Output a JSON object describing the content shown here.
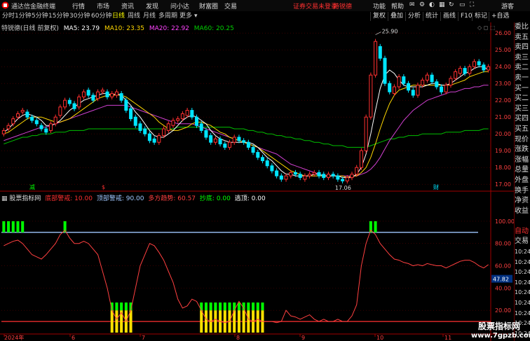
{
  "menu": {
    "app_name": "通达信金融终端",
    "items": [
      "行情",
      "市场",
      "资讯",
      "发现",
      "问小达",
      "财富圈",
      "交易"
    ],
    "login_status": "证券交易未登录",
    "stock_name": "特锐德",
    "right_items": [
      "功能",
      "帮助"
    ],
    "guest": "游客"
  },
  "tabs": {
    "periods": [
      "分时",
      "1分钟",
      "5分钟",
      "15分钟",
      "30分钟",
      "60分钟",
      "日线",
      "周线",
      "月线",
      "多周期",
      "更多"
    ],
    "active": "日线",
    "right_buttons": [
      "复权",
      "叠加",
      "分析",
      "统计",
      "画线",
      "F10",
      "标记",
      "+自选"
    ]
  },
  "main_chart": {
    "title": "特锐德(日线 前复权)",
    "ma": [
      {
        "label": "MA5: 23.79",
        "color": "#ffffff"
      },
      {
        "label": "MA10: 23.35",
        "color": "#ffd700"
      },
      {
        "label": "MA20: 22.92",
        "color": "#ff44ff"
      },
      {
        "label": "MA60: 20.25",
        "color": "#00d000"
      }
    ],
    "y_ticks": [
      "26.00",
      "25.00",
      "24.00",
      "23.00",
      "22.00",
      "21.00",
      "20.00",
      "19.00",
      "18.00",
      "17.00"
    ],
    "high_label": "25.90",
    "low_label": "17.06",
    "markers": [
      "减",
      "$",
      "财"
    ]
  },
  "indicator": {
    "title": "股票指标网",
    "params": [
      {
        "label": "底部警戒: 10.00",
        "color": "#ff3030"
      },
      {
        "label": "顶部警戒: 90.00",
        "color": "#a0c8ff"
      },
      {
        "label": "多方趋势: 60.57",
        "color": "#ff4040"
      },
      {
        "label": "抄底: 0.00",
        "color": "#00ff00"
      },
      {
        "label": "逃顶: 0.00",
        "color": "#ffffff"
      }
    ],
    "y_ticks": [
      "100.00",
      "80.00",
      "60.00",
      "40.00",
      "20.00"
    ],
    "current_value": "47.82"
  },
  "x_axis": [
    "2024年",
    "6",
    "7",
    "8",
    "9",
    "10",
    "11"
  ],
  "right_panel": [
    "委比",
    "卖五",
    "卖四",
    "卖三",
    "卖二",
    "卖一",
    "买一",
    "买二",
    "买三",
    "买四",
    "买五",
    "现价",
    "涨跌",
    "涨幅",
    "总量",
    "外盘",
    "换手",
    "净资",
    "收益",
    "",
    "自动",
    "交易",
    "10:24",
    "10:24",
    "10:24",
    "10:24",
    "10:24",
    "10:24",
    "10:24",
    "10:24",
    "10:24"
  ],
  "watermark": {
    "line1": "股票指标网",
    "line2": "www.7gpzb.com"
  },
  "chart_data": {
    "type": "candlestick",
    "ylim": [
      16.8,
      26.3
    ],
    "close": [
      20.2,
      20.5,
      20.9,
      21.2,
      21.4,
      21.0,
      20.8,
      20.6,
      20.3,
      20.1,
      20.6,
      21.0,
      21.6,
      22.0,
      21.8,
      21.5,
      22.2,
      22.5,
      22.3,
      22.0,
      22.5,
      22.6,
      22.2,
      22.4,
      22.5,
      22.0,
      21.4,
      20.9,
      20.5,
      20.2,
      20.0,
      19.6,
      19.5,
      19.9,
      20.3,
      20.6,
      20.8,
      20.9,
      21.2,
      21.4,
      21.0,
      20.5,
      20.2,
      19.8,
      19.5,
      19.7,
      19.4,
      19.2,
      19.5,
      19.8,
      19.6,
      19.5,
      19.2,
      18.9,
      18.6,
      18.4,
      18.1,
      17.8,
      17.5,
      17.3,
      17.5,
      17.7,
      17.6,
      17.4,
      17.5,
      17.6,
      17.7,
      17.5,
      17.4,
      17.6,
      17.5,
      17.3,
      17.2,
      17.4,
      17.6,
      18.0,
      19.0,
      21.0,
      23.5,
      25.5,
      24.5,
      23.0,
      22.5,
      22.8,
      23.4,
      23.0,
      22.6,
      22.3,
      22.9,
      23.2,
      23.5,
      23.1,
      22.8,
      22.5,
      22.9,
      23.3,
      23.7,
      23.9,
      23.6,
      24.0,
      24.3,
      24.1,
      23.8,
      24.0
    ],
    "open": [
      20.0,
      20.3,
      20.6,
      21.0,
      21.3,
      21.3,
      21.0,
      20.8,
      20.5,
      20.3,
      20.2,
      20.6,
      21.1,
      21.6,
      22.0,
      21.8,
      21.6,
      22.2,
      22.6,
      22.3,
      22.1,
      22.5,
      22.5,
      22.2,
      22.3,
      22.4,
      22.0,
      21.5,
      21.0,
      20.6,
      20.3,
      20.0,
      19.7,
      19.5,
      19.9,
      20.2,
      20.5,
      20.8,
      20.9,
      21.1,
      21.4,
      21.0,
      20.6,
      20.2,
      19.9,
      19.5,
      19.7,
      19.4,
      19.2,
      19.5,
      19.8,
      19.6,
      19.5,
      19.2,
      18.9,
      18.6,
      18.4,
      18.1,
      17.8,
      17.5,
      17.3,
      17.5,
      17.7,
      17.6,
      17.3,
      17.5,
      17.6,
      17.7,
      17.6,
      17.4,
      17.6,
      17.5,
      17.3,
      17.2,
      17.4,
      17.6,
      18.0,
      19.0,
      21.0,
      23.5,
      25.2,
      24.5,
      23.0,
      22.4,
      22.8,
      23.4,
      23.0,
      22.6,
      22.3,
      22.9,
      23.2,
      23.5,
      23.1,
      22.8,
      22.5,
      22.9,
      23.3,
      23.6,
      23.9,
      23.6,
      24.0,
      24.3,
      24.1,
      23.8
    ],
    "ma5": [
      20.1,
      20.3,
      20.6,
      20.9,
      21.1,
      21.2,
      21.1,
      21.0,
      20.8,
      20.5,
      20.5,
      20.6,
      20.8,
      21.1,
      21.4,
      21.6,
      21.8,
      22.0,
      22.1,
      22.2,
      22.3,
      22.4,
      22.4,
      22.3,
      22.4,
      22.3,
      22.0,
      21.7,
      21.3,
      21.0,
      20.6,
      20.2,
      19.9,
      19.8,
      19.8,
      20.0,
      20.2,
      20.5,
      20.8,
      21.0,
      21.1,
      21.0,
      20.8,
      20.6,
      20.2,
      19.9,
      19.7,
      19.6,
      19.5,
      19.5,
      19.5,
      19.5,
      19.5,
      19.4,
      19.2,
      18.9,
      18.6,
      18.4,
      18.1,
      17.8,
      17.6,
      17.6,
      17.5,
      17.5,
      17.5,
      17.5,
      17.6,
      17.6,
      17.5,
      17.5,
      17.5,
      17.5,
      17.4,
      17.4,
      17.4,
      17.6,
      18.0,
      18.8,
      20.0,
      21.4,
      22.7,
      23.5,
      23.8,
      23.6,
      23.2,
      22.9,
      22.8,
      22.8,
      22.8,
      22.8,
      22.9,
      23.0,
      23.0,
      22.9,
      22.9,
      23.0,
      23.2,
      23.4,
      23.6,
      23.7,
      23.9,
      24.0,
      24.0,
      23.8
    ],
    "ma10": [
      20.0,
      20.1,
      20.3,
      20.5,
      20.7,
      20.9,
      21.0,
      21.0,
      21.0,
      20.9,
      20.8,
      20.7,
      20.7,
      20.8,
      20.9,
      21.1,
      21.3,
      21.5,
      21.7,
      21.9,
      22.1,
      22.2,
      22.3,
      22.3,
      22.3,
      22.3,
      22.2,
      22.0,
      21.8,
      21.6,
      21.4,
      21.2,
      21.0,
      20.7,
      20.5,
      20.3,
      20.2,
      20.2,
      20.3,
      20.4,
      20.6,
      20.7,
      20.7,
      20.6,
      20.5,
      20.3,
      20.1,
      20.0,
      19.8,
      19.7,
      19.6,
      19.5,
      19.4,
      19.3,
      19.2,
      19.0,
      18.8,
      18.6,
      18.4,
      18.2,
      18.0,
      17.8,
      17.7,
      17.6,
      17.5,
      17.5,
      17.5,
      17.5,
      17.5,
      17.5,
      17.5,
      17.5,
      17.5,
      17.4,
      17.5,
      17.5,
      17.7,
      18.0,
      18.6,
      19.4,
      20.3,
      21.1,
      21.8,
      22.3,
      22.6,
      22.7,
      22.8,
      22.9,
      22.9,
      22.9,
      22.9,
      22.9,
      22.9,
      22.9,
      22.9,
      22.9,
      23.0,
      23.1,
      23.2,
      23.4,
      23.5,
      23.6,
      23.7,
      23.7
    ],
    "ma20": [
      19.6,
      19.7,
      19.8,
      19.9,
      20.0,
      20.1,
      20.2,
      20.3,
      20.4,
      20.4,
      20.5,
      20.6,
      20.7,
      20.8,
      20.9,
      21.0,
      21.1,
      21.2,
      21.3,
      21.4,
      21.5,
      21.6,
      21.7,
      21.7,
      21.7,
      21.7,
      21.7,
      21.6,
      21.5,
      21.4,
      21.3,
      21.2,
      21.1,
      21.0,
      20.9,
      20.8,
      20.7,
      20.6,
      20.6,
      20.6,
      20.6,
      20.5,
      20.4,
      20.3,
      20.2,
      20.1,
      20.0,
      19.9,
      19.8,
      19.7,
      19.6,
      19.5,
      19.4,
      19.3,
      19.2,
      19.1,
      19.0,
      18.9,
      18.8,
      18.6,
      18.4,
      18.2,
      18.1,
      18.0,
      17.9,
      17.8,
      17.7,
      17.6,
      17.5,
      17.5,
      17.5,
      17.5,
      17.5,
      17.5,
      17.5,
      17.5,
      17.6,
      17.7,
      17.9,
      18.2,
      18.6,
      19.1,
      19.6,
      20.0,
      20.4,
      20.8,
      21.1,
      21.4,
      21.6,
      21.8,
      22.0,
      22.1,
      22.2,
      22.3,
      22.4,
      22.5,
      22.5,
      22.6,
      22.7,
      22.7,
      22.8,
      22.8,
      22.9,
      22.9
    ],
    "ma60": [
      19.4,
      19.5,
      19.6,
      19.7,
      19.8,
      19.8,
      19.9,
      19.9,
      20.0,
      20.0,
      20.0,
      20.1,
      20.1,
      20.1,
      20.2,
      20.2,
      20.2,
      20.2,
      20.3,
      20.3,
      20.3,
      20.3,
      20.3,
      20.3,
      20.3,
      20.3,
      20.3,
      20.3,
      20.3,
      20.3,
      20.3,
      20.3,
      20.3,
      20.3,
      20.3,
      20.3,
      20.3,
      20.4,
      20.4,
      20.4,
      20.4,
      20.4,
      20.4,
      20.4,
      20.4,
      20.4,
      20.4,
      20.4,
      20.4,
      20.3,
      20.3,
      20.3,
      20.2,
      20.2,
      20.1,
      20.1,
      20.0,
      20.0,
      19.9,
      19.9,
      19.8,
      19.8,
      19.7,
      19.7,
      19.6,
      19.6,
      19.5,
      19.5,
      19.4,
      19.4,
      19.3,
      19.3,
      19.3,
      19.2,
      19.2,
      19.2,
      19.2,
      19.2,
      19.3,
      19.4,
      19.5,
      19.6,
      19.7,
      19.7,
      19.8,
      19.8,
      19.9,
      19.9,
      19.9,
      20.0,
      20.0,
      20.0,
      20.0,
      20.0,
      20.1,
      20.1,
      20.1,
      20.1,
      20.2,
      20.2,
      20.2,
      20.2,
      20.3,
      20.3
    ],
    "indicator_line": [
      78,
      80,
      82,
      83,
      80,
      75,
      70,
      68,
      66,
      70,
      75,
      80,
      88,
      92,
      85,
      80,
      80,
      82,
      80,
      75,
      70,
      55,
      40,
      20,
      12,
      18,
      10,
      20,
      40,
      60,
      70,
      80,
      78,
      72,
      65,
      55,
      45,
      30,
      22,
      24,
      30,
      28,
      20,
      12,
      10,
      12,
      10,
      9,
      10,
      20,
      28,
      22,
      12,
      10,
      12,
      10,
      10,
      10,
      9,
      10,
      20,
      15,
      14,
      12,
      14,
      16,
      12,
      10,
      12,
      10,
      10,
      12,
      10,
      10,
      15,
      25,
      60,
      80,
      92,
      88,
      80,
      75,
      70,
      66,
      65,
      63,
      62,
      60,
      61,
      60,
      62,
      61,
      60,
      60,
      58,
      60,
      62,
      64,
      65,
      65,
      63,
      60,
      58,
      61
    ],
    "bottom_signal_bars": [
      23,
      24,
      25,
      26,
      27,
      42,
      43,
      44,
      45,
      46,
      47,
      48,
      49,
      50,
      51,
      52,
      53,
      54,
      55
    ],
    "top_signal_bars": [
      0,
      1,
      2,
      3,
      4,
      13,
      78,
      79
    ]
  },
  "colors": {
    "up": "#ff3030",
    "down": "#00e5ff",
    "grid": "#5a0000",
    "axis": "#a00000"
  }
}
